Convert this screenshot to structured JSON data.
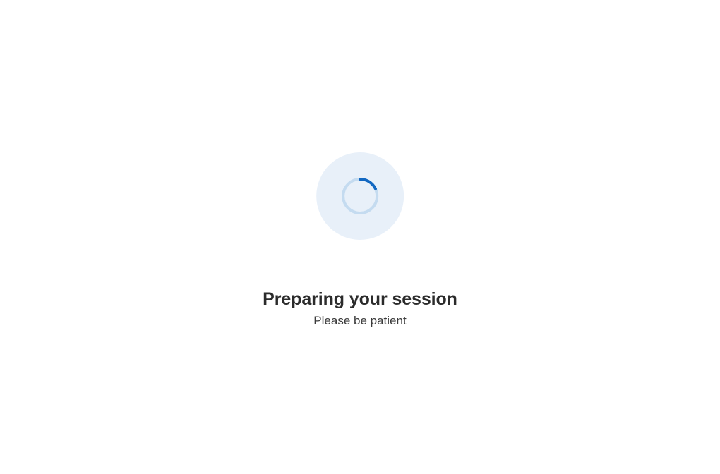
{
  "loading": {
    "title": "Preparing your session",
    "subtitle": "Please be patient"
  }
}
